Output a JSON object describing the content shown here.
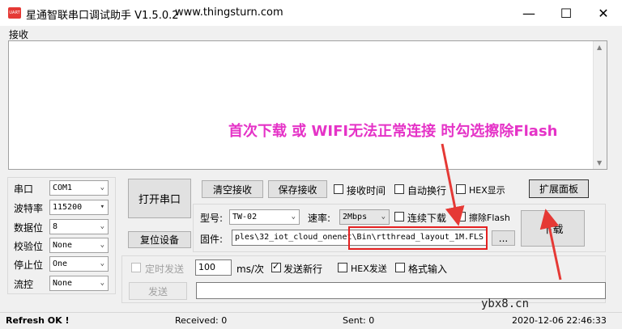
{
  "window": {
    "app_icon_text": "UART",
    "title": "星通智联串口调试助手 V1.5.0.2",
    "url": "www.thingsturn.com",
    "minimize_glyph": "—",
    "maximize_glyph": "☐",
    "close_glyph": "✕"
  },
  "receive": {
    "label": "接收",
    "annotation": "首次下载 或 WIFI无法正常连接 时勾选擦除Flash"
  },
  "serial": {
    "port_label": "串口",
    "port_value": "COM1",
    "baud_label": "波特率",
    "baud_value": "115200",
    "databits_label": "数据位",
    "databits_value": "8",
    "parity_label": "校验位",
    "parity_value": "None",
    "stopbits_label": "停止位",
    "stopbits_value": "One",
    "flow_label": "流控",
    "flow_value": "None"
  },
  "buttons": {
    "open_port": "打开串口",
    "reset_device": "复位设备",
    "clear_receive": "清空接收",
    "save_receive": "保存接收",
    "expand_panel": "扩展面板",
    "download": "下载",
    "browse": "...",
    "send": "发送"
  },
  "options": {
    "receive_time": "接收时间",
    "auto_wrap": "自动换行",
    "hex_display": "HEX显示",
    "continuous_download": "连续下载",
    "erase_flash": "擦除Flash",
    "timed_send": "定时发送",
    "send_newline": "发送新行",
    "hex_send": "HEX发送",
    "format_input": "格式输入"
  },
  "download": {
    "model_label": "型号:",
    "model_value": "TW-02",
    "speed_label": "速率:",
    "speed_value": "2Mbps",
    "firmware_label": "固件:",
    "firmware_path": "ples\\32_iot_cloud_onenet\\Bin\\rtthread_layout_1M.FLS"
  },
  "send": {
    "interval_value": "100",
    "interval_unit": "ms/次",
    "text_value": ""
  },
  "status": {
    "message": "Refresh OK !",
    "received": "Received: 0",
    "sent": "Sent: 0",
    "datetime": "2020-12-06 22:46:33"
  },
  "watermark": "ybx8.cn",
  "colors": {
    "annotation": "#e533c7",
    "highlight_box": "#e52020",
    "arrow": "#e53935"
  },
  "icons": [
    "app-uart-icon",
    "minimize-icon",
    "maximize-icon",
    "close-icon",
    "chevron-down-icon",
    "checkmark-icon",
    "annotation-arrow-icon"
  ]
}
